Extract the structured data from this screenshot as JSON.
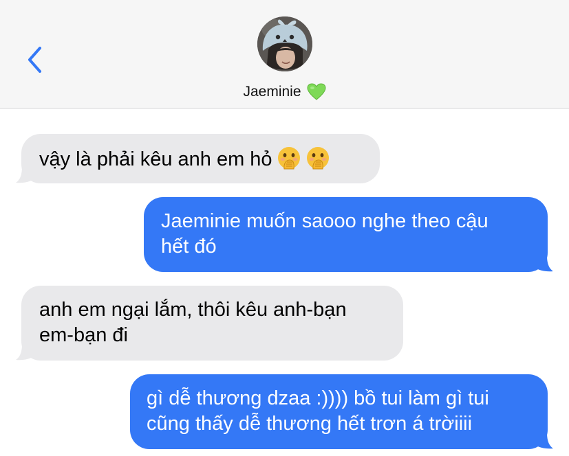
{
  "header": {
    "back_icon": "chevron-left-icon",
    "contact_name": "Jaeminie",
    "contact_emoji": "green-heart-icon",
    "accent_color": "#3478f6"
  },
  "messages": [
    {
      "direction": "received",
      "lines": [
        "vậy là phải kêu anh em hỏ"
      ],
      "emoji": [
        "hand-over-mouth-icon",
        "hand-over-mouth-icon"
      ]
    },
    {
      "direction": "sent",
      "lines": [
        "Jaeminie muốn saooo nghe theo cậu",
        "hết đó"
      ]
    },
    {
      "direction": "received",
      "lines": [
        "anh em ngại lắm, thôi kêu anh-bạn",
        "em-bạn đi"
      ]
    },
    {
      "direction": "sent",
      "lines": [
        "gì dễ thương dzaa :)))) bồ tui làm gì tui",
        "cũng thấy dễ thương hết trơn á trờiiii"
      ]
    }
  ],
  "colors": {
    "sent_bubble": "#3478f6",
    "received_bubble": "#e9e9eb",
    "header_bg": "#f6f6f6"
  }
}
